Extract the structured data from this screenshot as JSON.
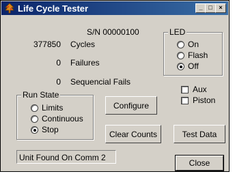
{
  "window": {
    "title": "Life Cycle Tester",
    "icon": "tree-icon"
  },
  "titlebar_buttons": {
    "minimize": "_",
    "maximize": "□",
    "close": "×"
  },
  "serial": "S/N 00000100",
  "counters": [
    {
      "value": "377850",
      "label": "Cycles"
    },
    {
      "value": "0",
      "label": "Failures"
    },
    {
      "value": "0",
      "label": "Sequencial Fails"
    }
  ],
  "led": {
    "legend": "LED",
    "options": [
      {
        "label": "On",
        "selected": false
      },
      {
        "label": "Flash",
        "selected": false
      },
      {
        "label": "Off",
        "selected": true
      }
    ]
  },
  "checkboxes": [
    {
      "label": "Aux",
      "checked": false
    },
    {
      "label": "Piston",
      "checked": false
    }
  ],
  "run_state": {
    "legend": "Run State",
    "options": [
      {
        "label": "Limits",
        "selected": false
      },
      {
        "label": "Continuous",
        "selected": false
      },
      {
        "label": "Stop",
        "selected": true
      }
    ]
  },
  "buttons": {
    "configure": "Configure",
    "clear_counts": "Clear Counts",
    "test_data": "Test Data",
    "close": "Close"
  },
  "status": "Unit Found On Comm 2"
}
